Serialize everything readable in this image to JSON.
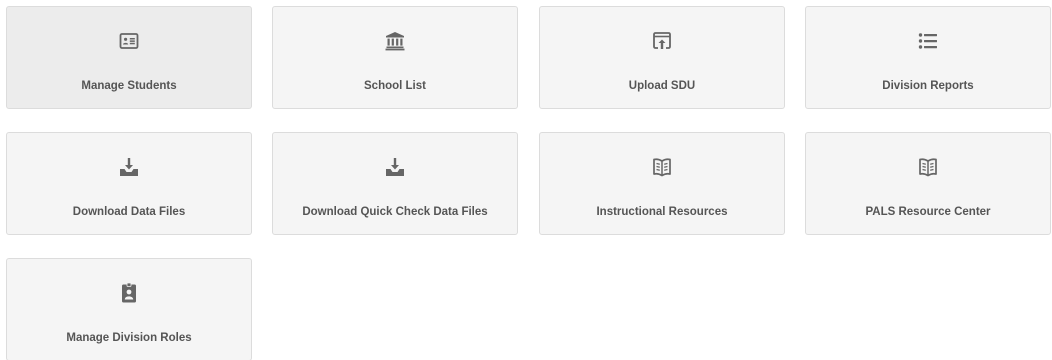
{
  "tiles": [
    {
      "label": "Manage Students",
      "icon": "id-card-icon"
    },
    {
      "label": "School List",
      "icon": "institution-icon"
    },
    {
      "label": "Upload SDU",
      "icon": "upload-icon"
    },
    {
      "label": "Division Reports",
      "icon": "list-icon"
    },
    {
      "label": "Download Data Files",
      "icon": "download-tray-icon"
    },
    {
      "label": "Download Quick Check Data Files",
      "icon": "download-tray-icon"
    },
    {
      "label": "Instructional Resources",
      "icon": "open-book-icon"
    },
    {
      "label": "PALS Resource Center",
      "icon": "open-book-icon"
    },
    {
      "label": "Manage Division Roles",
      "icon": "id-badge-icon"
    }
  ],
  "colors": {
    "icon": "#666666",
    "label": "#555555",
    "tile_bg": "#f5f5f5",
    "tile_bg_active": "#ececec",
    "tile_border": "#dcdcdc"
  }
}
